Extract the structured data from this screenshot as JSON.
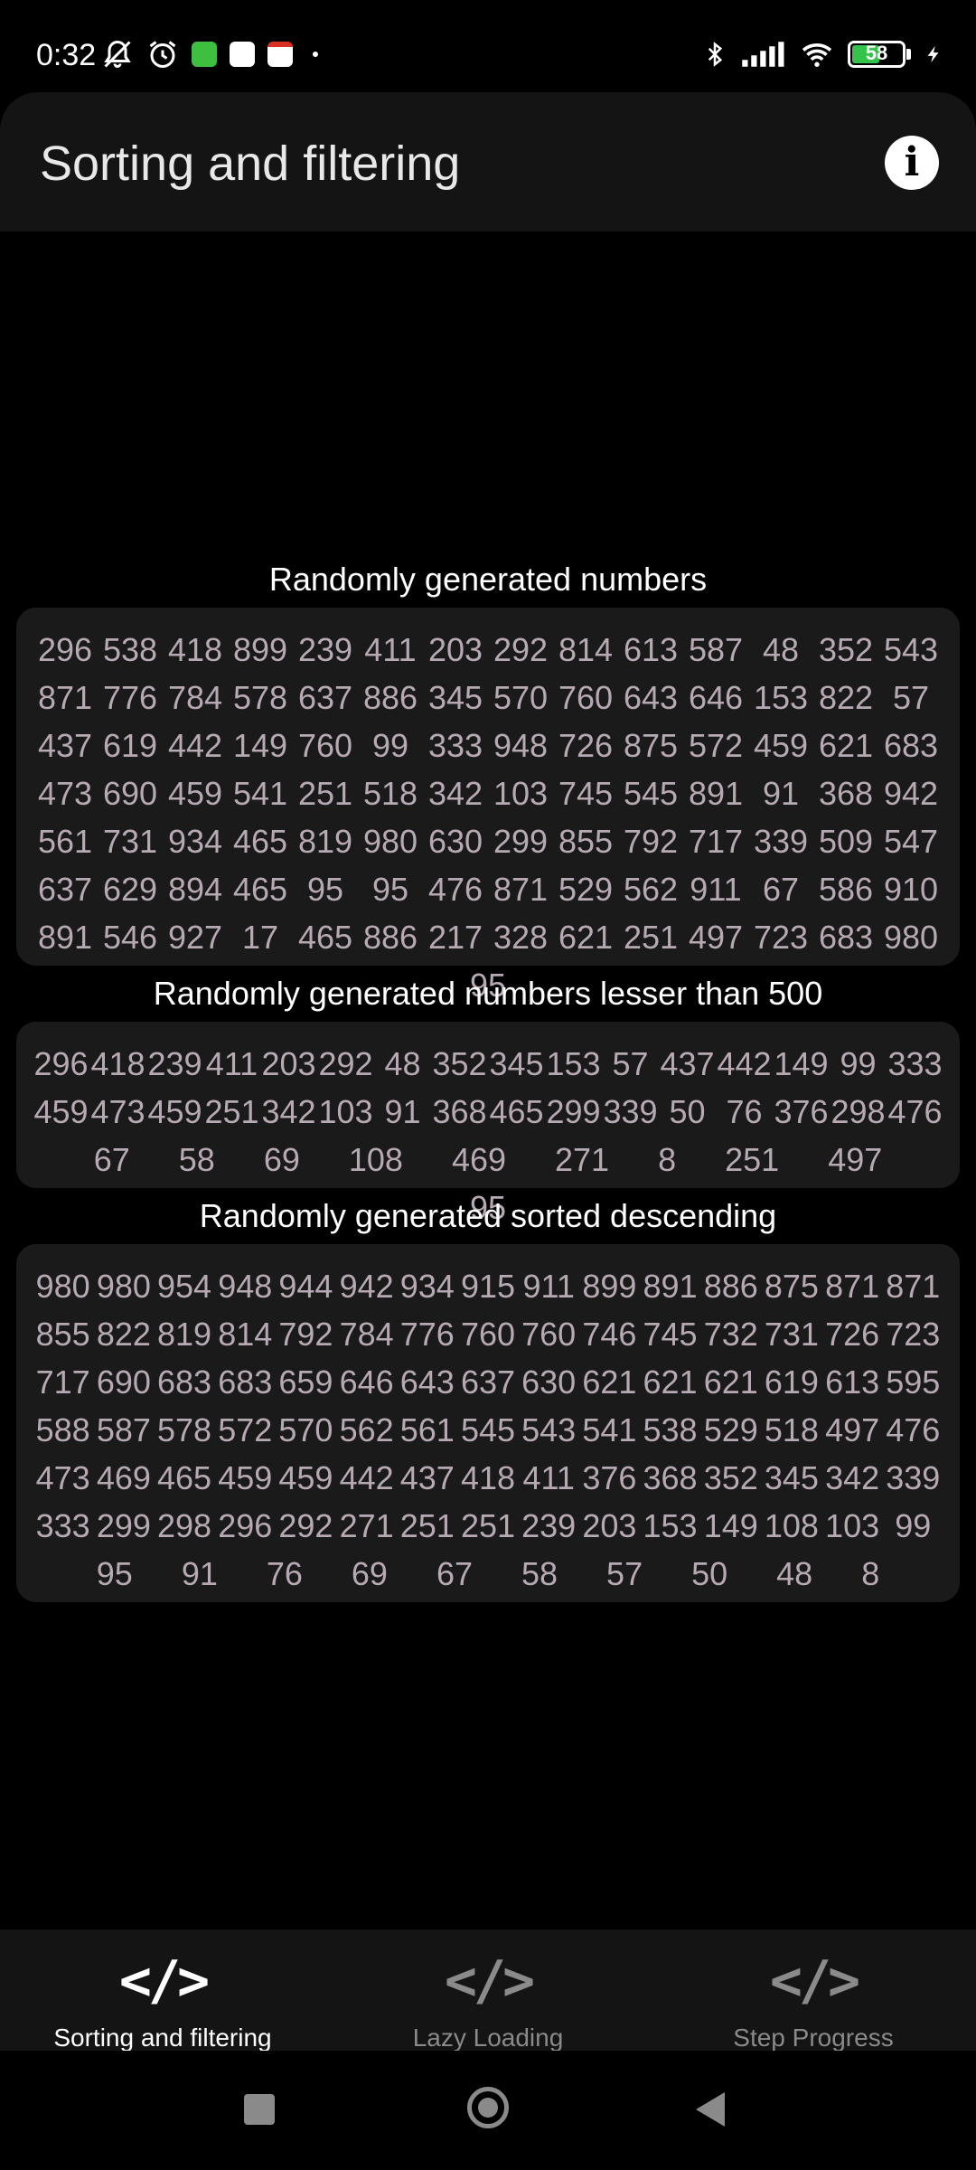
{
  "status_bar": {
    "time": "0:32",
    "battery": "58",
    "battery_level": 0.58,
    "left_icons": [
      "bell-off-icon",
      "alarm-icon",
      "green-app-icon",
      "runner-app-icon",
      "gmail-icon",
      "dot-icon"
    ],
    "right_icons": [
      "bluetooth-icon",
      "signal-icon",
      "wifi-icon",
      "battery-icon",
      "charging-icon"
    ]
  },
  "app_bar": {
    "title": "Sorting and filtering",
    "info_icon": "info-icon"
  },
  "sections": [
    {
      "title": "Randomly generated numbers",
      "numbers": [
        "296",
        "538",
        "418",
        "899",
        "239",
        "411",
        "203",
        "292",
        "814",
        "613",
        "587",
        "48",
        "352",
        "543",
        "871",
        "776",
        "784",
        "578",
        "637",
        "886",
        "345",
        "570",
        "760",
        "643",
        "646",
        "153",
        "822",
        "57",
        "437",
        "619",
        "442",
        "149",
        "760",
        "99",
        "333",
        "948",
        "726",
        "875",
        "572",
        "459",
        "621",
        "683",
        "473",
        "690",
        "459",
        "541",
        "251",
        "518",
        "342",
        "103",
        "745",
        "545",
        "891",
        "91",
        "368",
        "942",
        "561",
        "731",
        "934",
        "465",
        "819",
        "980",
        "630",
        "299",
        "855",
        "792",
        "717",
        "339",
        "509",
        "547",
        "637",
        "629",
        "894",
        "465",
        "95",
        "95",
        "476",
        "871",
        "529",
        "562",
        "911",
        "67",
        "586",
        "910",
        "891",
        "546",
        "927",
        "17",
        "465",
        "886",
        "217",
        "328",
        "621",
        "251",
        "497",
        "723",
        "683",
        "980",
        "95"
      ]
    },
    {
      "title": "Randomly generated numbers lesser than 500",
      "numbers": [
        "296",
        "418",
        "239",
        "411",
        "203",
        "292",
        "48",
        "352",
        "345",
        "153",
        "57",
        "437",
        "442",
        "149",
        "99",
        "333",
        "459",
        "473",
        "459",
        "251",
        "342",
        "103",
        "91",
        "368",
        "465",
        "299",
        "339",
        "50",
        "76",
        "376",
        "298",
        "476",
        "67",
        "58",
        "69",
        "108",
        "469",
        "271",
        "8",
        "251",
        "497",
        "95"
      ]
    },
    {
      "title": "Randomly generated sorted descending",
      "numbers": [
        "980",
        "980",
        "954",
        "948",
        "944",
        "942",
        "934",
        "915",
        "911",
        "899",
        "891",
        "886",
        "875",
        "871",
        "871",
        "855",
        "822",
        "819",
        "814",
        "792",
        "784",
        "776",
        "760",
        "760",
        "746",
        "745",
        "732",
        "731",
        "726",
        "723",
        "717",
        "690",
        "683",
        "683",
        "659",
        "646",
        "643",
        "637",
        "630",
        "621",
        "621",
        "621",
        "619",
        "613",
        "595",
        "588",
        "587",
        "578",
        "572",
        "570",
        "562",
        "561",
        "545",
        "543",
        "541",
        "538",
        "529",
        "518",
        "497",
        "476",
        "473",
        "469",
        "465",
        "459",
        "459",
        "442",
        "437",
        "418",
        "411",
        "376",
        "368",
        "352",
        "345",
        "342",
        "339",
        "333",
        "299",
        "298",
        "296",
        "292",
        "271",
        "251",
        "251",
        "239",
        "203",
        "153",
        "149",
        "108",
        "103",
        "99",
        "95",
        "91",
        "76",
        "69",
        "67",
        "58",
        "57",
        "50",
        "48",
        "8"
      ]
    }
  ],
  "bottom_nav": {
    "items": [
      {
        "label": "Sorting and filtering",
        "icon": "code-icon",
        "active": true
      },
      {
        "label": "Lazy Loading",
        "icon": "code-icon",
        "active": false
      },
      {
        "label": "Step Progress",
        "icon": "code-icon",
        "active": false
      }
    ]
  },
  "system_nav": [
    "recents-button",
    "home-button",
    "back-button"
  ]
}
